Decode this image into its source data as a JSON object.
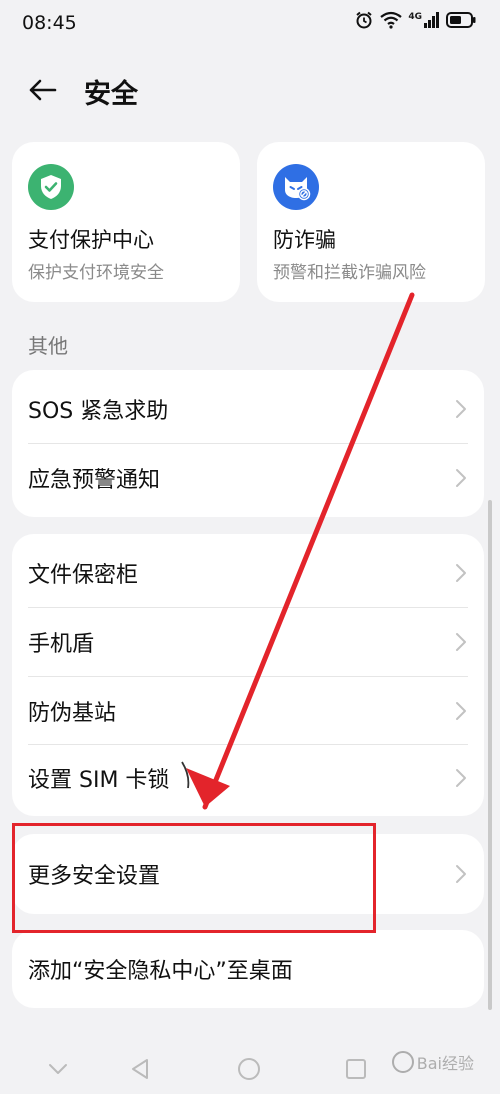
{
  "status_bar": {
    "time": "08:45",
    "signal_label": "4G",
    "icons": [
      "alarm-icon",
      "wifi-icon",
      "signal-icon",
      "battery-icon"
    ]
  },
  "header": {
    "title": "安全",
    "back_icon": "back-arrow-icon"
  },
  "feature_cards": [
    {
      "title": "支付保护中心",
      "subtitle": "保护支付环境安全",
      "icon": "shield-check-icon",
      "icon_color": "#3cb371"
    },
    {
      "title": "防诈骗",
      "subtitle": "预警和拦截诈骗风险",
      "icon": "anti-fraud-icon",
      "icon_color": "#2f6fe4"
    }
  ],
  "section_other": {
    "label": "其他"
  },
  "group1": [
    {
      "label": "SOS 紧急求助"
    },
    {
      "label": "应急预警通知"
    }
  ],
  "group2": [
    {
      "label": "文件保密柜"
    },
    {
      "label": "手机盾"
    },
    {
      "label": "防伪基站"
    },
    {
      "label": "设置 SIM 卡锁"
    }
  ],
  "group3": [
    {
      "label": "更多安全设置"
    }
  ],
  "group4": [
    {
      "label": "添加“安全隐私中心”至桌面"
    }
  ],
  "nav_bar": {
    "icons": [
      "nav-collapse-icon",
      "nav-back-icon",
      "nav-home-icon",
      "nav-recents-icon"
    ]
  },
  "annotation": {
    "highlight_color": "#e3242b"
  },
  "watermark": {
    "text": "Bai经验"
  }
}
